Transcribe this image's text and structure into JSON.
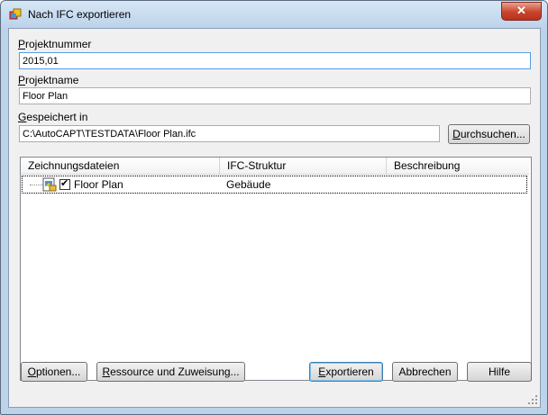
{
  "window": {
    "title": "Nach IFC exportieren",
    "close_glyph": "✕",
    "close_color": "#c8442d"
  },
  "project_number": {
    "label_prefix": "P",
    "label_rest": "rojektnummer",
    "value": "2015,01"
  },
  "project_name": {
    "label_prefix": "P",
    "label_rest": "rojektname",
    "value": "Floor Plan"
  },
  "saved_in": {
    "label_prefix": "G",
    "label_rest": "espeichert in",
    "value": "C:\\AutoCAPT\\TESTDATA\\Floor Plan.ifc",
    "browse_prefix": "D",
    "browse_rest": "urchsuchen..."
  },
  "table": {
    "columns": [
      "Zeichnungsdateien",
      "IFC-Struktur",
      "Beschreibung"
    ],
    "rows": [
      {
        "checked": true,
        "name": "Floor Plan",
        "structure": "Gebäude",
        "description": ""
      }
    ],
    "check_glyph": "✔"
  },
  "buttons": {
    "options_prefix": "O",
    "options_rest": "ptionen...",
    "resources_prefix": "R",
    "resources_rest": "essource und Zuweisung...",
    "export_prefix": "E",
    "export_rest": "xportieren",
    "cancel": "Abbrechen",
    "help": "Hilfe"
  },
  "icons": {
    "app": "ifc-app-icon",
    "document": "drawing-file-icon",
    "grip": "resize-grip-icon"
  }
}
